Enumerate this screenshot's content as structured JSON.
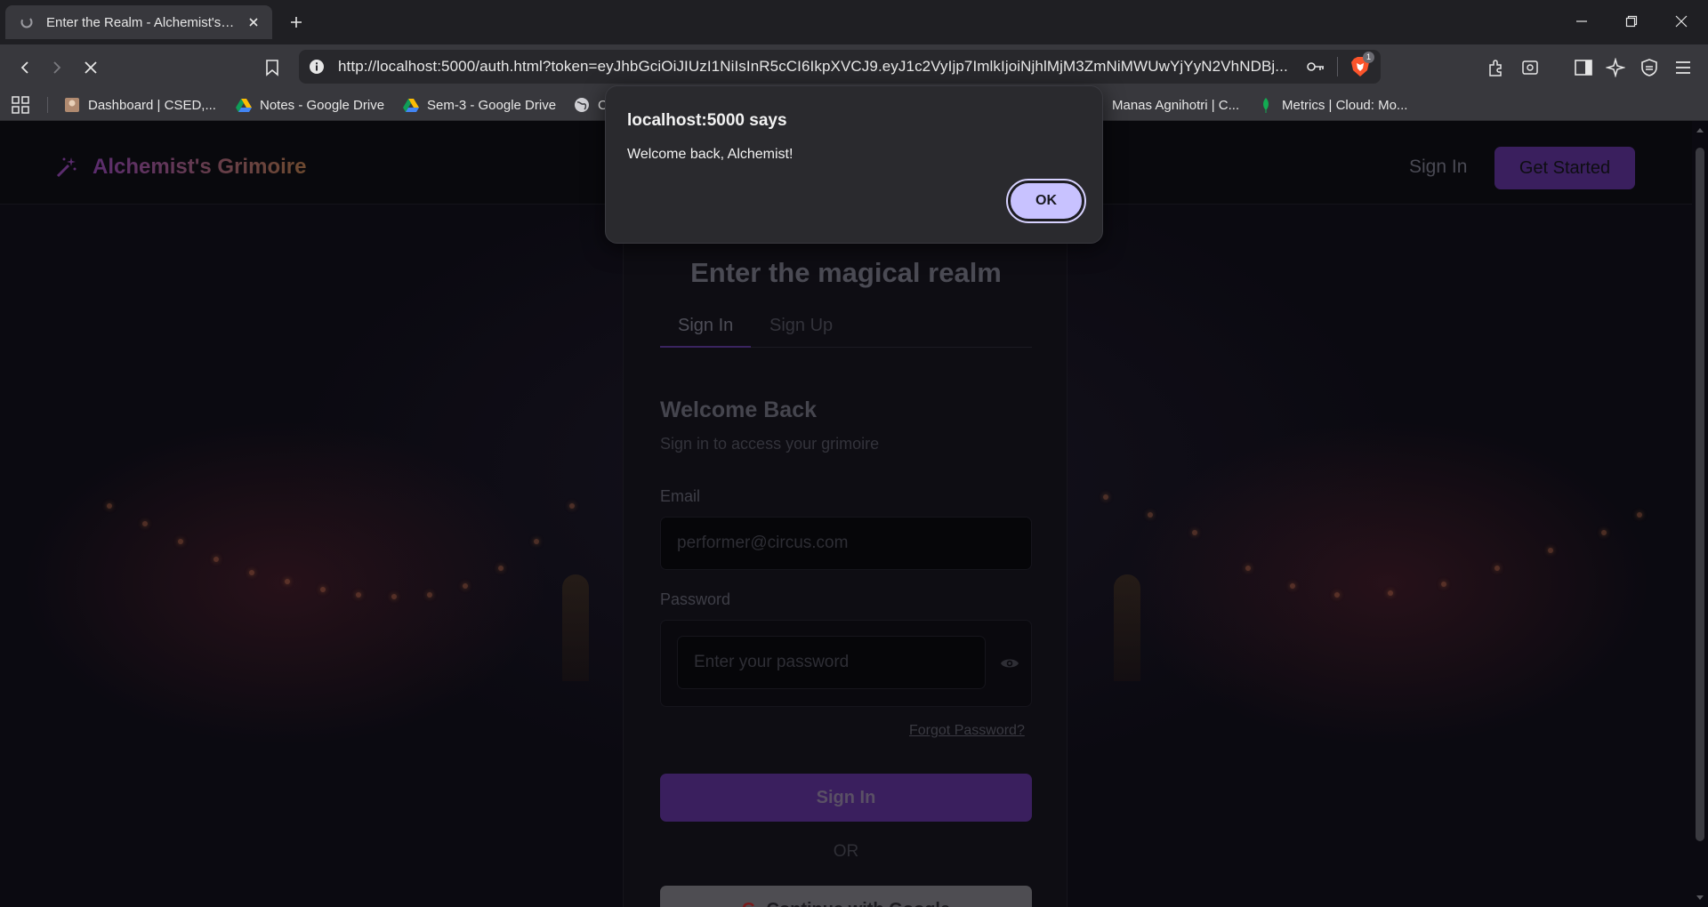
{
  "browser": {
    "tab_title": "Enter the Realm - Alchemist's Grimoire",
    "url": "http://localhost:5000/auth.html?token=eyJhbGciOiJIUzI1NiIsInR5cCI6IkpXVCJ9.eyJ1c2VyIjp7ImlkIjoiNjhlMjM3ZmNiMWUwYjYyN2VhNDBj...",
    "shields_badge": "1",
    "bookmarks": [
      {
        "label": "Dashboard | CSED,...",
        "icon": "avatar-icon"
      },
      {
        "label": "Notes - Google Drive",
        "icon": "google-drive-icon"
      },
      {
        "label": "Sem-3 - Google Drive",
        "icon": "google-drive-icon"
      },
      {
        "label": "C",
        "icon": "globe-icon"
      },
      {
        "label": "Manas Agnihotri | C...",
        "icon": "bookmark-icon"
      },
      {
        "label": "Metrics | Cloud: Mo...",
        "icon": "mongodb-leaf-icon"
      }
    ]
  },
  "site": {
    "brand": "Alchemist's Grimoire",
    "nav_signin": "Sign In",
    "nav_cta": "Get Started"
  },
  "auth": {
    "heading": "Enter the magical realm",
    "tabs": [
      "Sign In",
      "Sign Up"
    ],
    "active_tab": "Sign In",
    "welcome_title": "Welcome Back",
    "welcome_subtitle": "Sign in to access your grimoire",
    "email_label": "Email",
    "email_placeholder": "performer@circus.com",
    "password_label": "Password",
    "password_placeholder": "Enter your password",
    "forgot_link": "Forgot Password?",
    "submit_label": "Sign In",
    "divider": "OR",
    "google_label": "Continue with Google"
  },
  "dialog": {
    "title": "localhost:5000 says",
    "message": "Welcome back, Alchemist!",
    "ok_label": "OK"
  },
  "colors": {
    "accent": "#3a1f5e",
    "dialog_button": "#c8c2ff",
    "page_bg": "#0b0a11"
  }
}
